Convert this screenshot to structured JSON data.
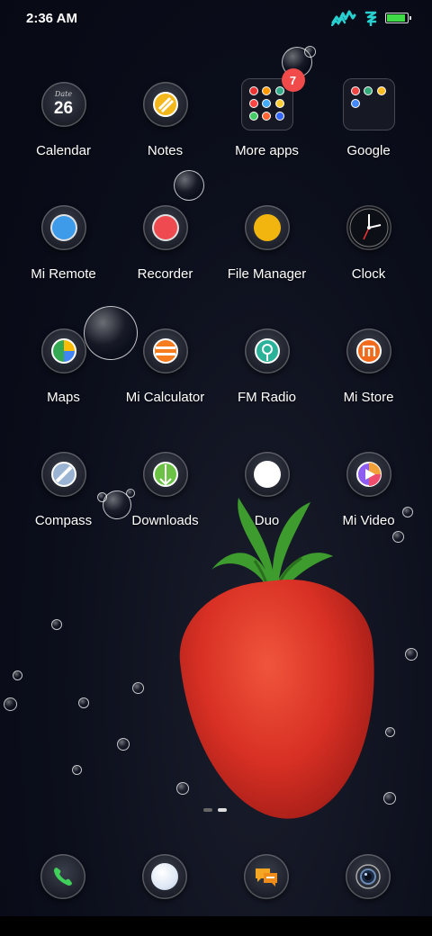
{
  "status_bar": {
    "time": "2:36 AM",
    "battery_level": 0.9
  },
  "apps": [
    {
      "label": "Calendar",
      "icon": "calendar-icon",
      "calendar_header": "Date",
      "calendar_day": "26"
    },
    {
      "label": "Notes",
      "icon": "notes-icon"
    },
    {
      "label": "More apps",
      "icon": "folder-icon",
      "badge": "7"
    },
    {
      "label": "Google",
      "icon": "google-folder-icon"
    },
    {
      "label": "Mi Remote",
      "icon": "remote-icon"
    },
    {
      "label": "Recorder",
      "icon": "recorder-icon"
    },
    {
      "label": "File Manager",
      "icon": "file-manager-icon"
    },
    {
      "label": "Clock",
      "icon": "clock-icon"
    },
    {
      "label": "Maps",
      "icon": "maps-icon"
    },
    {
      "label": "Mi Calculator",
      "icon": "calculator-icon"
    },
    {
      "label": "FM Radio",
      "icon": "fm-radio-icon"
    },
    {
      "label": "Mi Store",
      "icon": "mi-store-icon"
    },
    {
      "label": "Compass",
      "icon": "compass-icon"
    },
    {
      "label": "Downloads",
      "icon": "downloads-icon"
    },
    {
      "label": "Duo",
      "icon": "duo-icon"
    },
    {
      "label": "Mi Video",
      "icon": "video-icon"
    }
  ],
  "dock": [
    {
      "icon": "phone-icon"
    },
    {
      "icon": "browser-icon"
    },
    {
      "icon": "messages-icon"
    },
    {
      "icon": "camera-icon"
    }
  ],
  "page_indicator": {
    "pages": 2,
    "current": 2
  },
  "colors": {
    "badge": "#f04a4a",
    "battery": "#3fdc48",
    "signal": "#28d0d0"
  }
}
